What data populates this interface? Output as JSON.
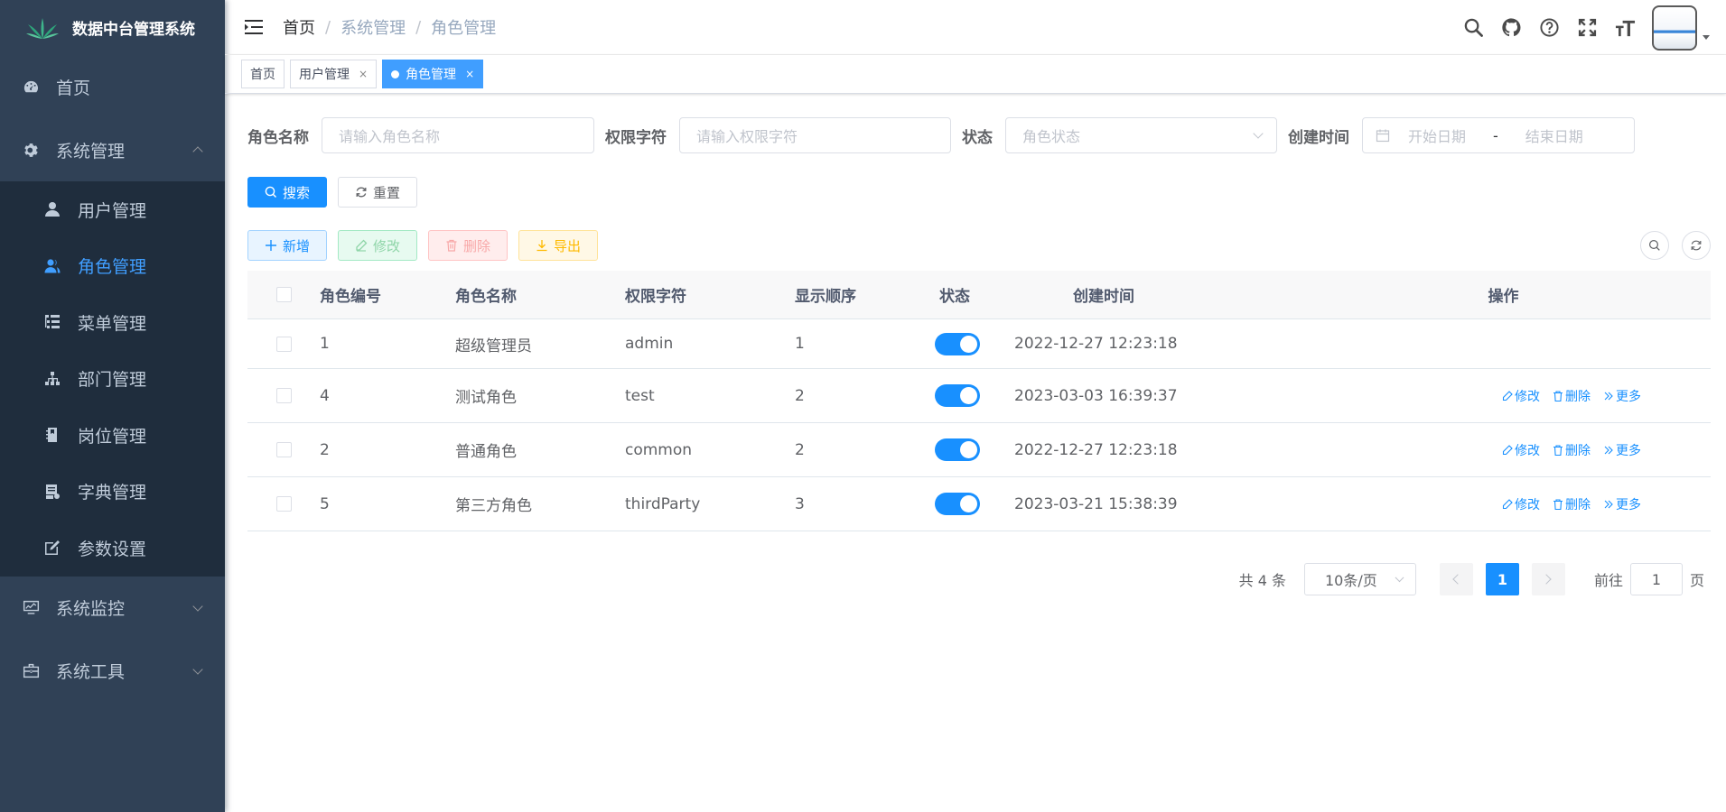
{
  "app": {
    "title": "数据中台管理系统"
  },
  "sidebar": {
    "items": [
      {
        "label": "首页",
        "icon": "dashboard-icon"
      },
      {
        "label": "系统管理",
        "icon": "gear-icon",
        "expanded": true,
        "children": [
          {
            "label": "用户管理",
            "icon": "user-icon",
            "active": false
          },
          {
            "label": "角色管理",
            "icon": "peoples-icon",
            "active": true
          },
          {
            "label": "菜单管理",
            "icon": "tree-table-icon",
            "active": false
          },
          {
            "label": "部门管理",
            "icon": "tree-icon",
            "active": false
          },
          {
            "label": "岗位管理",
            "icon": "post-icon",
            "active": false
          },
          {
            "label": "字典管理",
            "icon": "dict-icon",
            "active": false
          },
          {
            "label": "参数设置",
            "icon": "edit-icon",
            "active": false
          }
        ]
      },
      {
        "label": "系统监控",
        "icon": "monitor-icon",
        "expanded": false
      },
      {
        "label": "系统工具",
        "icon": "tool-icon",
        "expanded": false
      }
    ]
  },
  "navbar": {
    "breadcrumb": [
      "首页",
      "系统管理",
      "角色管理"
    ]
  },
  "tags": [
    {
      "label": "首页",
      "closable": false,
      "active": false
    },
    {
      "label": "用户管理",
      "closable": true,
      "active": false
    },
    {
      "label": "角色管理",
      "closable": true,
      "active": true
    }
  ],
  "search": {
    "role_name_label": "角色名称",
    "role_name_placeholder": "请输入角色名称",
    "role_key_label": "权限字符",
    "role_key_placeholder": "请输入权限字符",
    "status_label": "状态",
    "status_placeholder": "角色状态",
    "created_label": "创建时间",
    "start_placeholder": "开始日期",
    "range_separator": "-",
    "end_placeholder": "结束日期",
    "search_button": "搜索",
    "reset_button": "重置"
  },
  "toolbar": {
    "add": "新增",
    "edit": "修改",
    "delete": "删除",
    "export": "导出"
  },
  "table": {
    "columns": [
      "角色编号",
      "角色名称",
      "权限字符",
      "显示顺序",
      "状态",
      "创建时间",
      "操作"
    ],
    "rows": [
      {
        "id": "1",
        "name": "超级管理员",
        "key": "admin",
        "order": "1",
        "enabled": true,
        "created": "2022-12-27 12:23:18",
        "actions": []
      },
      {
        "id": "4",
        "name": "测试角色",
        "key": "test",
        "order": "2",
        "enabled": true,
        "created": "2023-03-03 16:39:37",
        "actions": [
          "修改",
          "删除",
          "更多"
        ]
      },
      {
        "id": "2",
        "name": "普通角色",
        "key": "common",
        "order": "2",
        "enabled": true,
        "created": "2022-12-27 12:23:18",
        "actions": [
          "修改",
          "删除",
          "更多"
        ]
      },
      {
        "id": "5",
        "name": "第三方角色",
        "key": "thirdParty",
        "order": "3",
        "enabled": true,
        "created": "2023-03-21 15:38:39",
        "actions": [
          "修改",
          "删除",
          "更多"
        ]
      }
    ]
  },
  "pagination": {
    "total_text": "共 4 条",
    "page_size": "10条/页",
    "current_page": "1",
    "goto_prefix": "前往",
    "goto_value": "1",
    "goto_suffix": "页"
  },
  "colors": {
    "sidebar_bg": "#304156",
    "submenu_bg": "#1f2d3d",
    "primary": "#1890ff",
    "active_menu": "#409eff"
  }
}
